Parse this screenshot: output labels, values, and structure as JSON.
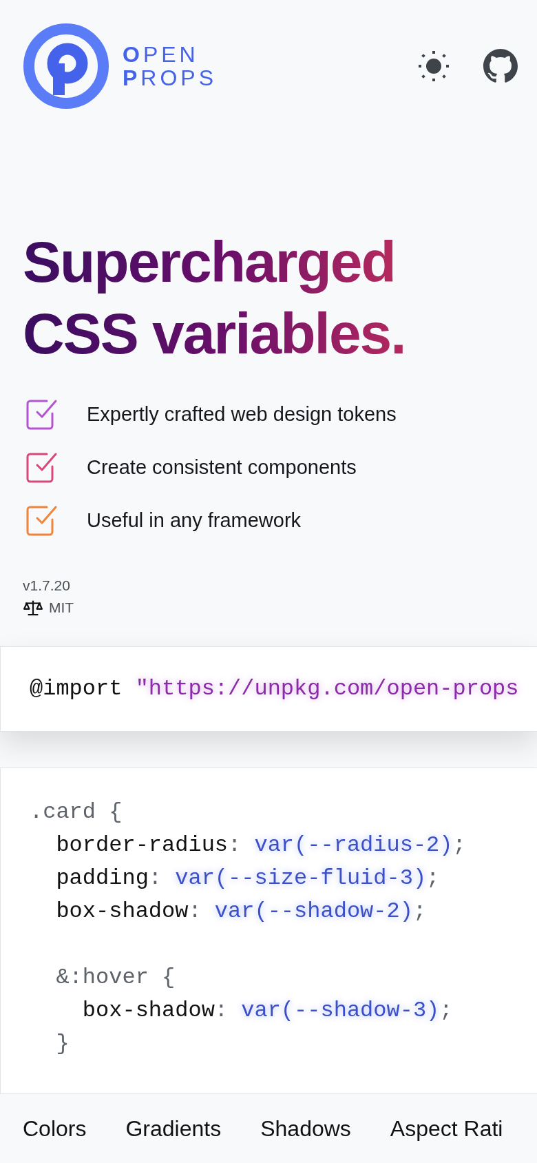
{
  "header": {
    "logo_lines": [
      "**O**PEN",
      "**P**ROPS"
    ]
  },
  "headline": [
    "Supercharged",
    "CSS variables."
  ],
  "features": [
    {
      "label": "Expertly crafted web design tokens",
      "checked": true,
      "color": "#b455d0"
    },
    {
      "label": "Create consistent components",
      "checked": true,
      "color": "#d8487c"
    },
    {
      "label": "Useful in any framework",
      "checked": true,
      "color": "#f0843a"
    }
  ],
  "version": "v1.7.20",
  "license": "MIT",
  "import_code": [
    {
      "kind": "keyword",
      "text": "@import "
    },
    {
      "kind": "string",
      "text": "\"https://unpkg.com/open-props"
    }
  ],
  "card_code": [
    {
      "kind": "code",
      "tokens": [
        {
          "kind": "punct",
          "text": ".card {"
        }
      ]
    },
    {
      "kind": "code",
      "tokens": [
        {
          "kind": "prop",
          "text": "  border-radius"
        },
        {
          "kind": "punct",
          "text": ": "
        },
        {
          "kind": "value",
          "text": "var(--radius-2)"
        },
        {
          "kind": "punct",
          "text": ";"
        }
      ]
    },
    {
      "kind": "code",
      "tokens": [
        {
          "kind": "prop",
          "text": "  padding"
        },
        {
          "kind": "punct",
          "text": ": "
        },
        {
          "kind": "value",
          "text": "var(--size-fluid-3)"
        },
        {
          "kind": "punct",
          "text": ";"
        }
      ]
    },
    {
      "kind": "code",
      "tokens": [
        {
          "kind": "prop",
          "text": "  box-shadow"
        },
        {
          "kind": "punct",
          "text": ": "
        },
        {
          "kind": "value",
          "text": "var(--shadow-2)"
        },
        {
          "kind": "punct",
          "text": ";"
        }
      ]
    },
    {
      "kind": "blank"
    },
    {
      "kind": "code",
      "tokens": [
        {
          "kind": "punct",
          "text": "  &:hover {"
        }
      ]
    },
    {
      "kind": "code",
      "tokens": [
        {
          "kind": "prop",
          "text": "    box-shadow"
        },
        {
          "kind": "punct",
          "text": ": "
        },
        {
          "kind": "value",
          "text": "var(--shadow-3)"
        },
        {
          "kind": "punct",
          "text": ";"
        }
      ]
    },
    {
      "kind": "code",
      "tokens": [
        {
          "kind": "punct",
          "text": "  }"
        }
      ]
    }
  ],
  "nav": [
    "Colors",
    "Gradients",
    "Shadows",
    "Aspect Rati"
  ]
}
